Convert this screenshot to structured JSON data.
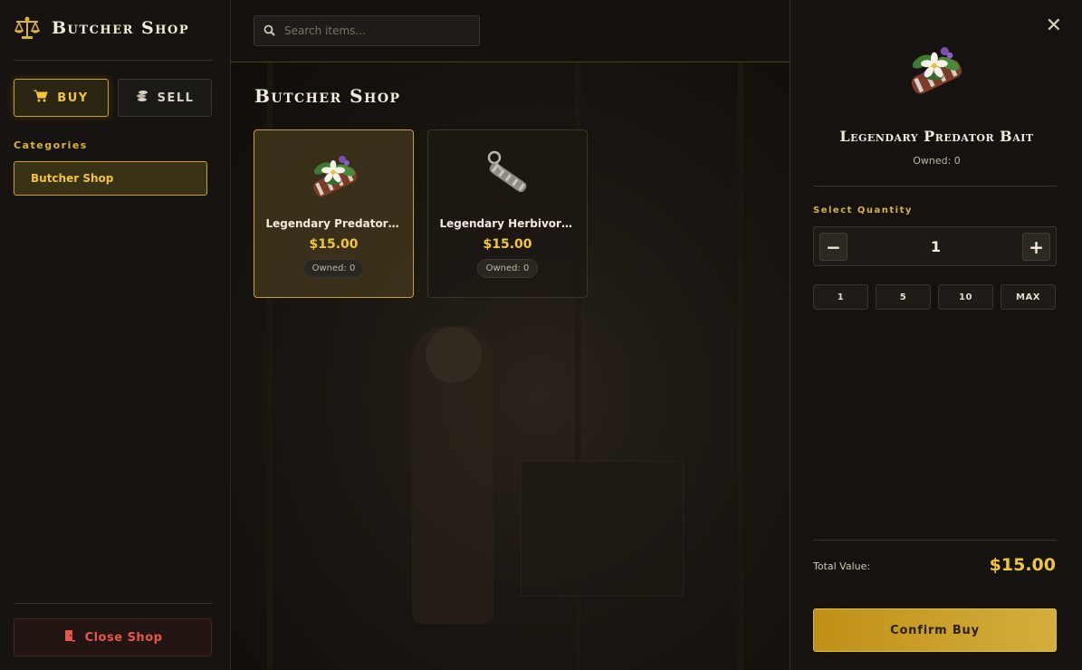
{
  "sidebar": {
    "title": "Butcher Shop",
    "tabs": {
      "buy": "BUY",
      "sell": "SELL"
    },
    "categories_label": "Categories",
    "categories": [
      {
        "label": "Butcher Shop",
        "selected": true
      }
    ],
    "close_label": "Close Shop"
  },
  "search": {
    "placeholder": "Search items..."
  },
  "main": {
    "title": "Butcher Shop",
    "items": [
      {
        "name": "Legendary Predator B...",
        "price": "$15.00",
        "owned": "Owned: 0",
        "selected": true,
        "icon": "predator-bait-icon"
      },
      {
        "name": "Legendary Herbivore ...",
        "price": "$15.00",
        "owned": "Owned: 0",
        "selected": false,
        "icon": "herbivore-bait-icon"
      }
    ]
  },
  "detail": {
    "name": "Legendary Predator Bait",
    "owned": "Owned: 0",
    "quantity_label": "Select Quantity",
    "quantity": "1",
    "minus": "−",
    "plus": "+",
    "presets": [
      "1",
      "5",
      "10",
      "MAX"
    ],
    "total_label": "Total Value:",
    "total_value": "$15.00",
    "confirm_label": "Confirm Buy",
    "close": "✕"
  },
  "colors": {
    "accent": "#c9a227",
    "gold_text": "#f0c63a",
    "danger": "#e4574b",
    "background": "#15120d"
  }
}
